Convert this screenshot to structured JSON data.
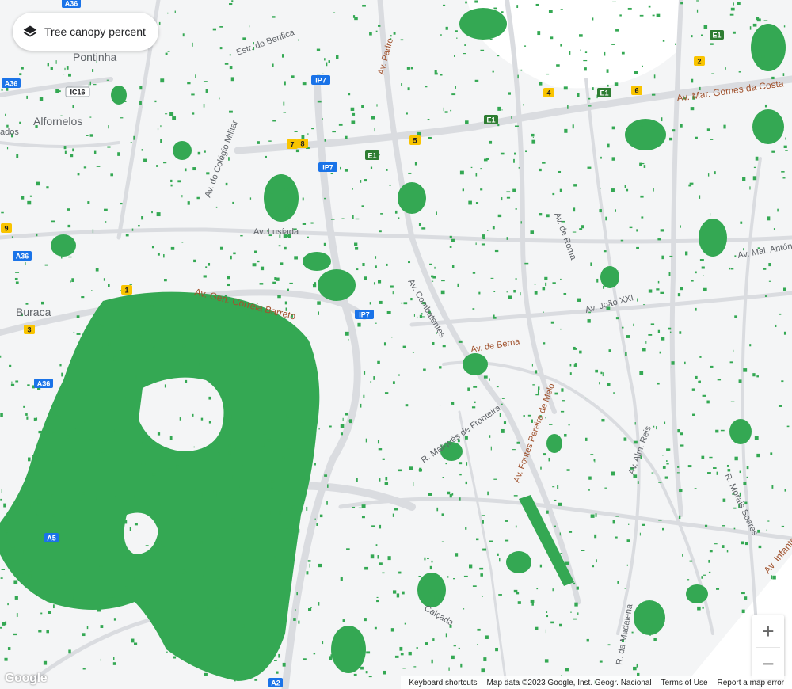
{
  "layer_button": {
    "label": "Tree canopy percent",
    "icon": "layers-icon"
  },
  "place_labels": [
    {
      "id": "ponthina",
      "text": "Pontinha"
    },
    {
      "id": "alfornelos",
      "text": "Alfornelos"
    },
    {
      "id": "buraca",
      "text": "Buraca"
    },
    {
      "id": "ados",
      "text": "ados"
    }
  ],
  "street_labels": [
    {
      "id": "av-mar-gomes",
      "text": "Av. Mar. Gomes da Costa"
    },
    {
      "id": "av-gen-correia",
      "text": "Av. Gen. Correia Barreto"
    },
    {
      "id": "av-lusiada",
      "text": "Av. Lusíada"
    },
    {
      "id": "av-padre",
      "text": "Av. Padre"
    },
    {
      "id": "av-mal-antonio",
      "text": "Av. Mal. António de S"
    },
    {
      "id": "av-berna",
      "text": "Av. de Berna"
    },
    {
      "id": "av-marques-fronteira",
      "text": "R. Marquês de Fronteira"
    },
    {
      "id": "av-almirante",
      "text": "Av. Alm. Reis"
    },
    {
      "id": "r-da-madalena",
      "text": "R. da Madalena"
    },
    {
      "id": "calcada",
      "text": "Calçada"
    },
    {
      "id": "av-infante",
      "text": "Av. Infante"
    },
    {
      "id": "r-alfredo",
      "text": "R. Morais Soares"
    },
    {
      "id": "av-joao",
      "text": "Av. João XXI"
    },
    {
      "id": "av-roma",
      "text": "Av. de Roma"
    },
    {
      "id": "av-fontes",
      "text": "Av. Fontes Pereira de Melo"
    },
    {
      "id": "av-combatentes",
      "text": "Av. Combatentes"
    },
    {
      "id": "colegio-militar",
      "text": "Av. do Colégio Militar"
    },
    {
      "id": "estr-benfica",
      "text": "Estr. de Benfica"
    }
  ],
  "road_shields": [
    {
      "id": "a36-1",
      "text": "A36",
      "color": "#1a73e8"
    },
    {
      "id": "a36-2",
      "text": "A36",
      "color": "#1a73e8"
    },
    {
      "id": "a36-3",
      "text": "A36",
      "color": "#1a73e8"
    },
    {
      "id": "a36-4",
      "text": "A36",
      "color": "#1a73e8"
    },
    {
      "id": "ic16",
      "text": "IC16",
      "color": "#ffffff"
    },
    {
      "id": "ip7-1",
      "text": "IP7",
      "color": "#1a73e8"
    },
    {
      "id": "ip7-2",
      "text": "IP7",
      "color": "#1a73e8"
    },
    {
      "id": "ip7-3",
      "text": "IP7",
      "color": "#1a73e8"
    },
    {
      "id": "a5",
      "text": "A5",
      "color": "#1a73e8"
    },
    {
      "id": "a2",
      "text": "A2",
      "color": "#1a73e8"
    },
    {
      "id": "e1-1",
      "text": "E1",
      "color": "#2e7d32"
    },
    {
      "id": "e1-2",
      "text": "E1",
      "color": "#2e7d32"
    },
    {
      "id": "e1-3",
      "text": "E1",
      "color": "#2e7d32"
    },
    {
      "id": "e1-4",
      "text": "E1",
      "color": "#2e7d32"
    },
    {
      "id": "n4",
      "text": "4",
      "color": "#f9c400"
    },
    {
      "id": "n5",
      "text": "5",
      "color": "#f9c400"
    },
    {
      "id": "n2",
      "text": "2",
      "color": "#f9c400"
    },
    {
      "id": "n6",
      "text": "6",
      "color": "#f9c400"
    },
    {
      "id": "n7",
      "text": "7",
      "color": "#f9c400"
    },
    {
      "id": "n8",
      "text": "8",
      "color": "#f9c400"
    },
    {
      "id": "n1",
      "text": "1",
      "color": "#f9c400"
    },
    {
      "id": "n3",
      "text": "3",
      "color": "#f9c400"
    },
    {
      "id": "n9",
      "text": "9",
      "color": "#f9c400"
    }
  ],
  "colors": {
    "canopy": "#34a853",
    "road": "#dadce0",
    "background": "#f4f5f6",
    "water": "#ffffff",
    "road_label": "#a0522d"
  },
  "zoom": {
    "in_label": "+",
    "out_label": "−"
  },
  "logo": "Google",
  "attribution": {
    "keyboard": "Keyboard shortcuts",
    "data": "Map data ©2023 Google, Inst. Geogr. Nacional",
    "terms": "Terms of Use",
    "report": "Report a map error"
  }
}
